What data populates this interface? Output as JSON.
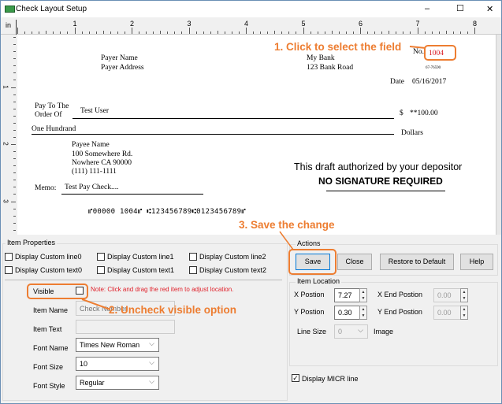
{
  "window": {
    "title": "Check Layout Setup",
    "minimize": "–",
    "maximize": "☐",
    "close": "✕"
  },
  "ruler": {
    "unit": "in",
    "marks": [
      "1",
      "2",
      "3",
      "4",
      "5",
      "6",
      "7",
      "8"
    ],
    "left_marks": [
      "1",
      "2",
      "3"
    ]
  },
  "check": {
    "payer_name": "Payer Name",
    "payer_address": "Payer Address",
    "bank_name": "My Bank",
    "bank_address": "123 Bank Road",
    "no_label": "No.",
    "check_number": "1004",
    "routing_fraction": "67-76590",
    "date_label": "Date",
    "date": "05/16/2017",
    "pay_to_1": "Pay To The",
    "pay_to_2": "Order Of",
    "payee": "Test User",
    "dollar_sign": "$",
    "amount": "**100.00",
    "amount_words": "One Hundrand",
    "dollars_label": "Dollars",
    "payee_lines": [
      "Payee Name",
      "100 Somewhere Rd.",
      "Nowhere CA 90000",
      "(111) 111-1111"
    ],
    "draft_text": "This draft authorized by your depositor",
    "no_signature": "NO SIGNATURE REQUIRED",
    "memo_label": "Memo:",
    "memo": "Test Pay Check....",
    "micr": "⑈00000 1004⑈ ⑆123456789⑆0123456789⑈"
  },
  "annotations": {
    "step1": "1. Click to select the field",
    "step2": "2. Uncheck visible option",
    "step3": "3. Save the change",
    "color": "#ed7d31"
  },
  "item_properties": {
    "title": "Item Properties",
    "checkboxes": [
      "Display Custom line0",
      "Display Custom line1",
      "Display Custom line2",
      "Display Custom text0",
      "Display Custom text1",
      "Display Custom text2"
    ],
    "visible_label": "Visible",
    "note": "Note: Click and drag the red item to adjust location.",
    "item_name_label": "Item Name",
    "item_name_placeholder": "Check Number",
    "item_text_label": "Item Text",
    "font_name_label": "Font Name",
    "font_name": "Times New Roman",
    "font_size_label": "Font Size",
    "font_size": "10",
    "font_style_label": "Font Style",
    "font_style": "Regular"
  },
  "actions": {
    "title": "Actions",
    "save": "Save",
    "close": "Close",
    "restore": "Restore to Default",
    "help": "Help"
  },
  "location": {
    "title": "Item Location",
    "x_label": "X Postion",
    "x": "7.27",
    "x_end_label": "X End Postion",
    "x_end": "0.00",
    "y_label": "Y Postion",
    "y": "0.30",
    "y_end_label": "Y End Postion",
    "y_end": "0.00",
    "line_size_label": "Line Size",
    "line_size": "0",
    "image_label": "Image"
  },
  "micr_toggle": {
    "label": "Display MICR line",
    "checked": true
  }
}
